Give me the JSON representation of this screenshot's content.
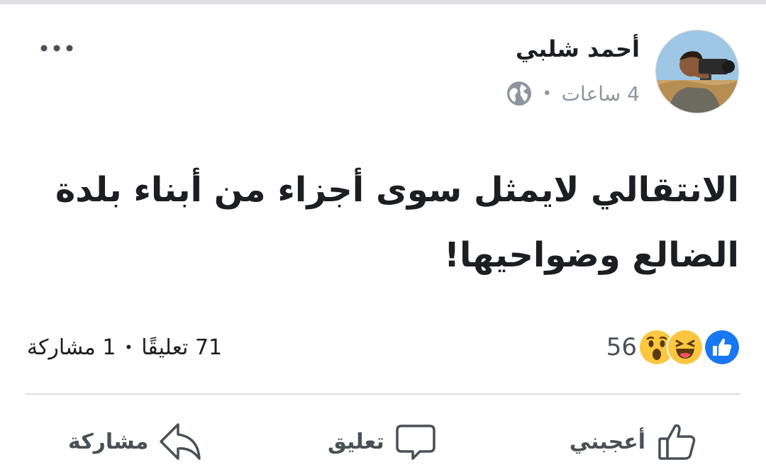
{
  "post": {
    "author": "أحمد شلبي",
    "time": "4 ساعات",
    "text_line1": "الانتقالي لايمثل سوى أجزاء من أبناء  بلدة",
    "text_line2": "الضالع وضواحيها!",
    "privacy_icon": "globe-icon",
    "more_icon": "more-options-icon"
  },
  "stats": {
    "reactions_count": "56",
    "reaction_types": [
      "like",
      "haha",
      "wow"
    ],
    "comments": "71 تعليقًا",
    "shares": "1 مشاركة"
  },
  "actions": {
    "like": "أعجبني",
    "comment": "تعليق",
    "share": "مشاركة"
  },
  "colors": {
    "like_blue": "#1877f2",
    "emoji_yellow": "#fcc63f",
    "secondary_text": "#90949c",
    "divider": "#dadde1"
  }
}
